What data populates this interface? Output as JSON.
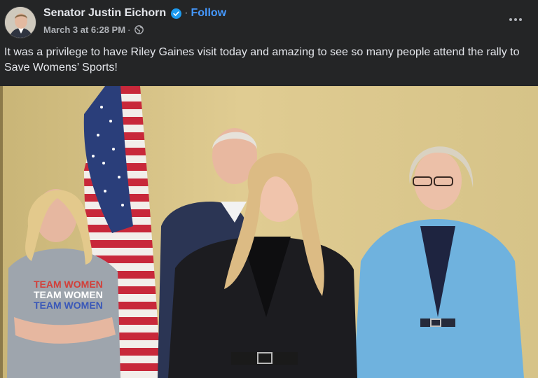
{
  "post": {
    "author": "Senator Justin Eichorn",
    "separator": "·",
    "follow_label": "Follow",
    "date": "March 3 at 6:28 PM",
    "meta_separator": "·",
    "audience_icon": "globe-icon",
    "verified_icon": "verified-badge-icon",
    "more_icon": "more-options-icon",
    "text": "It was a privilege to have Riley Gaines visit today and amazing to see so many people attend the rally to Save Womens’ Sports!"
  },
  "photo": {
    "shirt_text": [
      "TEAM WOMEN",
      "TEAM WOMEN",
      "TEAM WOMEN"
    ]
  },
  "colors": {
    "background": "#242526",
    "text": "#e4e6eb",
    "secondary_text": "#b0b3b8",
    "link": "#4599ff",
    "verified": "#1d9bf0",
    "wall": "#d8c487"
  }
}
